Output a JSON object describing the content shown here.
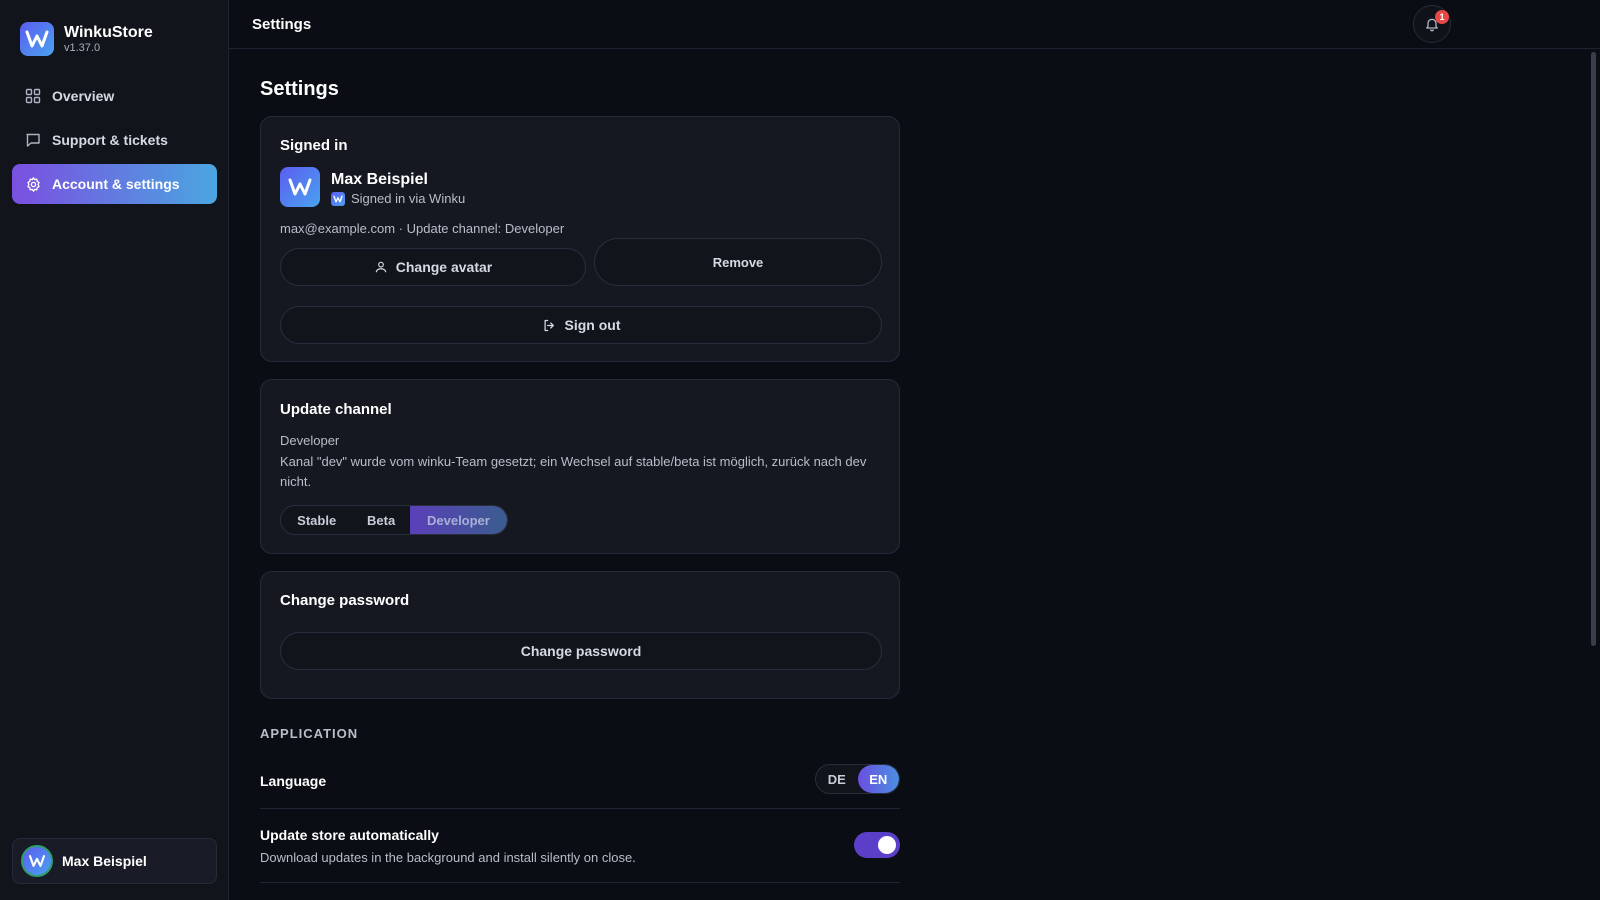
{
  "app": {
    "name": "WinkuStore",
    "version": "v1.37.0"
  },
  "sidebar": {
    "items": [
      {
        "label": "Overview",
        "icon": "grid-icon",
        "active": false
      },
      {
        "label": "Support & tickets",
        "icon": "chat-icon",
        "active": false
      },
      {
        "label": "Account & settings",
        "icon": "gear-icon",
        "active": true
      }
    ],
    "user": {
      "name": "Max Beispiel"
    }
  },
  "topbar": {
    "title": "Settings",
    "notifications_count": "1"
  },
  "main": {
    "title": "Settings",
    "signed_in": {
      "heading": "Signed in",
      "name": "Max Beispiel",
      "provider_text": "Signed in via Winku",
      "meta": "max@example.com · Update channel: Developer",
      "change_avatar_label": "Change avatar",
      "remove_label": "Remove",
      "sign_out_label": "Sign out"
    },
    "update_channel": {
      "heading": "Update channel",
      "current": "Developer",
      "description": "Kanal \"dev\" wurde vom winku-Team gesetzt; ein Wechsel auf stable/beta ist möglich, zurück nach dev nicht.",
      "options": [
        "Stable",
        "Beta",
        "Developer"
      ],
      "selected": "Developer"
    },
    "change_password": {
      "heading": "Change password",
      "button_label": "Change password"
    },
    "application": {
      "section_label": "APPLICATION",
      "language": {
        "label": "Language",
        "options": [
          "DE",
          "EN"
        ],
        "selected": "EN"
      },
      "auto_update": {
        "label": "Update store automatically",
        "description": "Download updates in the background and install silently on close.",
        "enabled": true
      }
    }
  },
  "colors": {
    "accent_purple": "#7b4fe0",
    "accent_blue": "#4aa6e0",
    "background": "#0b0d14",
    "badge_red": "#e64848"
  }
}
